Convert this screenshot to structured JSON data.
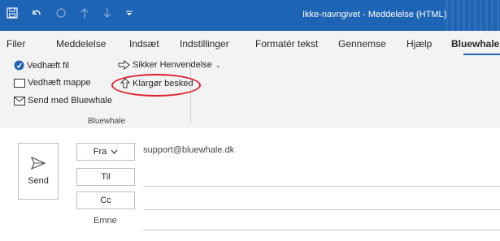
{
  "window": {
    "title": "Ikke-navngivet - Meddelelse (HTML)"
  },
  "colors": {
    "titlebar": "#1e64b4",
    "callout": "#e0202a"
  },
  "quick_access": [
    "save-icon",
    "undo-icon",
    "redo-icon",
    "up-icon",
    "down-icon",
    "customize-icon"
  ],
  "tabs": [
    "Filer",
    "Meddelelse",
    "Indsæt",
    "Indstillinger",
    "Formatér tekst",
    "Gennemse",
    "Hjælp",
    "Bluewhale"
  ],
  "ribbon": {
    "attach_file": "Vedhæft fil",
    "attach_folder": "Vedhæft mappe",
    "send_with": "Send med Bluewhale",
    "secure_request": "Sikker Henvendelse",
    "prepare_message": "Klargør besked",
    "group_label": "Bluewhale"
  },
  "compose": {
    "send": "Send",
    "from_label": "Fra",
    "from_value": "support@bluewhale.dk",
    "to_label": "Til",
    "cc_label": "Cc",
    "subject_label": "Emne"
  }
}
